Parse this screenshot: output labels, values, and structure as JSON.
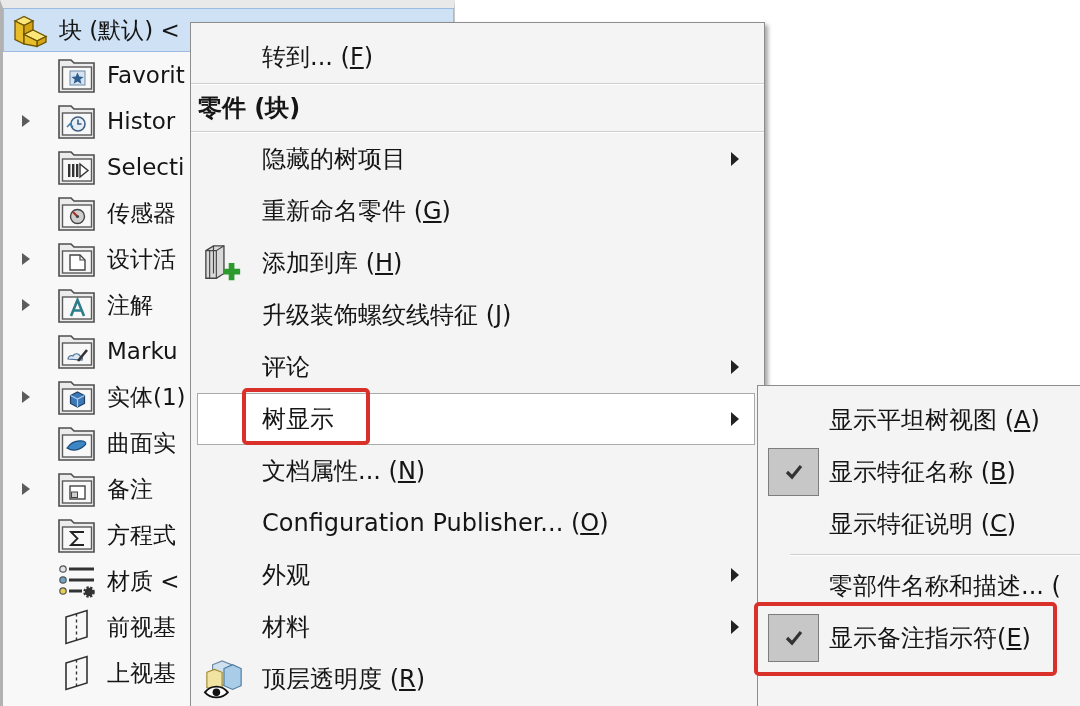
{
  "tree": {
    "label": "块 (默认) <",
    "kind": "part",
    "selected": true,
    "children": [
      {
        "label": "Favorit",
        "kind": "favorites",
        "expandable": false,
        "selected": false
      },
      {
        "label": "Histor",
        "kind": "history",
        "expandable": true,
        "selected": false
      },
      {
        "label": "Selecti",
        "kind": "selection",
        "expandable": false,
        "selected": false
      },
      {
        "label": "传感器",
        "kind": "sensors",
        "expandable": false,
        "selected": false
      },
      {
        "label": "设计活",
        "kind": "binder",
        "expandable": true,
        "selected": false
      },
      {
        "label": "注解",
        "kind": "annotations",
        "expandable": true,
        "selected": false
      },
      {
        "label": "Marku",
        "kind": "markup",
        "expandable": false,
        "selected": false
      },
      {
        "label": "实体(1)",
        "kind": "solids",
        "expandable": true,
        "selected": false
      },
      {
        "label": "曲面实",
        "kind": "surfaces",
        "expandable": false,
        "selected": false
      },
      {
        "label": "备注",
        "kind": "notes",
        "expandable": true,
        "selected": false
      },
      {
        "label": "方程式",
        "kind": "equations",
        "expandable": false,
        "selected": false
      },
      {
        "label": "材质 <",
        "kind": "material",
        "expandable": false,
        "selected": false
      },
      {
        "label": "前视基",
        "kind": "plane",
        "expandable": false,
        "selected": false
      },
      {
        "label": "上视基",
        "kind": "plane",
        "expandable": false,
        "selected": false
      }
    ]
  },
  "context_menu": {
    "items": [
      {
        "kind": "command",
        "label": "转到... (",
        "mnemonic": "F",
        "suffix": ")",
        "submenu": false,
        "selected": false,
        "outlined": false
      },
      {
        "kind": "separator"
      },
      {
        "kind": "header",
        "label": "零件 (块)"
      },
      {
        "kind": "separator"
      },
      {
        "kind": "command",
        "label": "隐藏的树项目",
        "submenu": true,
        "selected": false,
        "outlined": false
      },
      {
        "kind": "command",
        "label": "重新命名零件 (",
        "mnemonic": "G",
        "suffix": ")",
        "submenu": false,
        "selected": false,
        "outlined": false
      },
      {
        "kind": "library",
        "label": "添加到库 (",
        "mnemonic": "H",
        "suffix": ")",
        "submenu": false,
        "selected": false,
        "outlined": false
      },
      {
        "kind": "command",
        "label": "升级装饰螺纹线特征 (",
        "mnemonic": "J",
        "suffix": ")",
        "submenu": false,
        "selected": false,
        "outlined": false
      },
      {
        "kind": "command",
        "label": "评论",
        "submenu": true,
        "selected": false,
        "outlined": false
      },
      {
        "kind": "command",
        "label": "树显示",
        "submenu": true,
        "selected": true,
        "outlined": true
      },
      {
        "kind": "command",
        "label": "文档属性... (",
        "mnemonic": "N",
        "suffix": ")",
        "submenu": false,
        "selected": false,
        "outlined": false
      },
      {
        "kind": "command",
        "label": "Configuration Publisher... (",
        "mnemonic": "O",
        "suffix": ")",
        "submenu": false,
        "selected": false,
        "outlined": false
      },
      {
        "kind": "command",
        "label": "外观",
        "submenu": true,
        "selected": false,
        "outlined": false
      },
      {
        "kind": "command",
        "label": "材料",
        "submenu": true,
        "selected": false,
        "outlined": false
      },
      {
        "kind": "transparency",
        "label": "顶层透明度 (",
        "mnemonic": "R",
        "suffix": ")",
        "submenu": false,
        "selected": false,
        "outlined": false
      }
    ]
  },
  "submenu": {
    "items": [
      {
        "kind": "option",
        "label": "显示平坦树视图 (",
        "mnemonic": "A",
        "suffix": ")",
        "checked": false,
        "selected": false,
        "outlined": false
      },
      {
        "kind": "option",
        "label": "显示特征名称 (",
        "mnemonic": "B",
        "suffix": ")",
        "checked": true,
        "selected": false,
        "outlined": false
      },
      {
        "kind": "option",
        "label": "显示特征说明 (",
        "mnemonic": "C",
        "suffix": ")",
        "checked": false,
        "selected": false,
        "outlined": false
      },
      {
        "kind": "separator"
      },
      {
        "kind": "option",
        "label": "零部件名称和描述... (",
        "checked": false,
        "selected": false,
        "outlined": false
      },
      {
        "kind": "option",
        "label": "显示备注指示符(",
        "mnemonic": "E",
        "suffix": ")",
        "checked": true,
        "selected": false,
        "outlined": true
      }
    ]
  }
}
